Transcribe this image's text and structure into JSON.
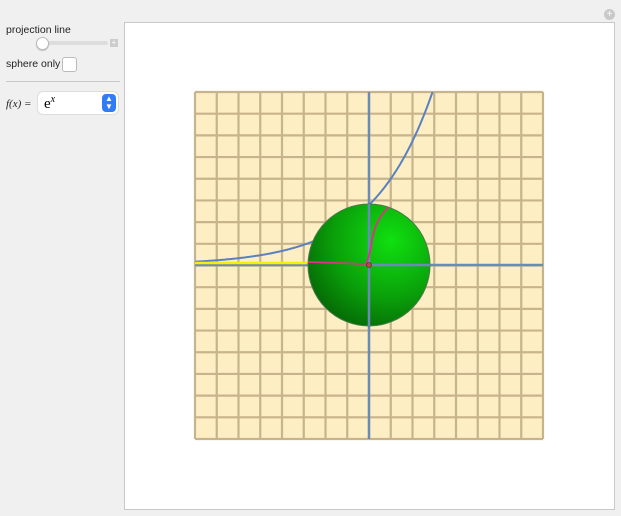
{
  "controls": {
    "projection_line_label": "projection line",
    "projection_line_value": 0,
    "sphere_only_label": "sphere only",
    "sphere_only_checked": false,
    "function_label": "f(x) =",
    "function_base": "e",
    "function_exponent": "x"
  },
  "plot": {
    "grid_color": "#c8b48c",
    "background_color": "#fdeec4",
    "axis_color": "#6a8ab8",
    "curve_color": "#5a80c0",
    "sphere_color": "#10c010",
    "projection_color": "#e0308a",
    "shadow_color": "#f5f000"
  }
}
